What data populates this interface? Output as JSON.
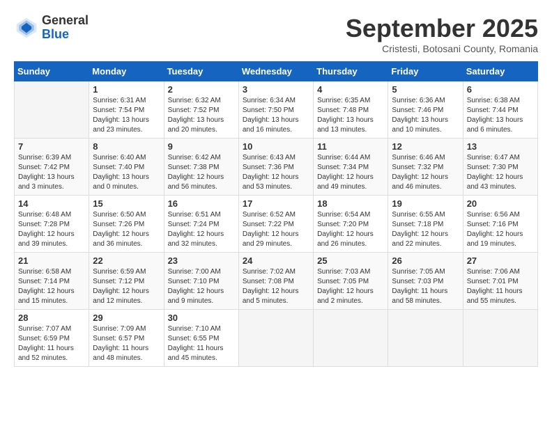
{
  "logo": {
    "general": "General",
    "blue": "Blue"
  },
  "header": {
    "month": "September 2025",
    "location": "Cristesti, Botosani County, Romania"
  },
  "weekdays": [
    "Sunday",
    "Monday",
    "Tuesday",
    "Wednesday",
    "Thursday",
    "Friday",
    "Saturday"
  ],
  "weeks": [
    [
      {
        "day": "",
        "sunrise": "",
        "sunset": "",
        "daylight": ""
      },
      {
        "day": "1",
        "sunrise": "Sunrise: 6:31 AM",
        "sunset": "Sunset: 7:54 PM",
        "daylight": "Daylight: 13 hours and 23 minutes."
      },
      {
        "day": "2",
        "sunrise": "Sunrise: 6:32 AM",
        "sunset": "Sunset: 7:52 PM",
        "daylight": "Daylight: 13 hours and 20 minutes."
      },
      {
        "day": "3",
        "sunrise": "Sunrise: 6:34 AM",
        "sunset": "Sunset: 7:50 PM",
        "daylight": "Daylight: 13 hours and 16 minutes."
      },
      {
        "day": "4",
        "sunrise": "Sunrise: 6:35 AM",
        "sunset": "Sunset: 7:48 PM",
        "daylight": "Daylight: 13 hours and 13 minutes."
      },
      {
        "day": "5",
        "sunrise": "Sunrise: 6:36 AM",
        "sunset": "Sunset: 7:46 PM",
        "daylight": "Daylight: 13 hours and 10 minutes."
      },
      {
        "day": "6",
        "sunrise": "Sunrise: 6:38 AM",
        "sunset": "Sunset: 7:44 PM",
        "daylight": "Daylight: 13 hours and 6 minutes."
      }
    ],
    [
      {
        "day": "7",
        "sunrise": "Sunrise: 6:39 AM",
        "sunset": "Sunset: 7:42 PM",
        "daylight": "Daylight: 13 hours and 3 minutes."
      },
      {
        "day": "8",
        "sunrise": "Sunrise: 6:40 AM",
        "sunset": "Sunset: 7:40 PM",
        "daylight": "Daylight: 13 hours and 0 minutes."
      },
      {
        "day": "9",
        "sunrise": "Sunrise: 6:42 AM",
        "sunset": "Sunset: 7:38 PM",
        "daylight": "Daylight: 12 hours and 56 minutes."
      },
      {
        "day": "10",
        "sunrise": "Sunrise: 6:43 AM",
        "sunset": "Sunset: 7:36 PM",
        "daylight": "Daylight: 12 hours and 53 minutes."
      },
      {
        "day": "11",
        "sunrise": "Sunrise: 6:44 AM",
        "sunset": "Sunset: 7:34 PM",
        "daylight": "Daylight: 12 hours and 49 minutes."
      },
      {
        "day": "12",
        "sunrise": "Sunrise: 6:46 AM",
        "sunset": "Sunset: 7:32 PM",
        "daylight": "Daylight: 12 hours and 46 minutes."
      },
      {
        "day": "13",
        "sunrise": "Sunrise: 6:47 AM",
        "sunset": "Sunset: 7:30 PM",
        "daylight": "Daylight: 12 hours and 43 minutes."
      }
    ],
    [
      {
        "day": "14",
        "sunrise": "Sunrise: 6:48 AM",
        "sunset": "Sunset: 7:28 PM",
        "daylight": "Daylight: 12 hours and 39 minutes."
      },
      {
        "day": "15",
        "sunrise": "Sunrise: 6:50 AM",
        "sunset": "Sunset: 7:26 PM",
        "daylight": "Daylight: 12 hours and 36 minutes."
      },
      {
        "day": "16",
        "sunrise": "Sunrise: 6:51 AM",
        "sunset": "Sunset: 7:24 PM",
        "daylight": "Daylight: 12 hours and 32 minutes."
      },
      {
        "day": "17",
        "sunrise": "Sunrise: 6:52 AM",
        "sunset": "Sunset: 7:22 PM",
        "daylight": "Daylight: 12 hours and 29 minutes."
      },
      {
        "day": "18",
        "sunrise": "Sunrise: 6:54 AM",
        "sunset": "Sunset: 7:20 PM",
        "daylight": "Daylight: 12 hours and 26 minutes."
      },
      {
        "day": "19",
        "sunrise": "Sunrise: 6:55 AM",
        "sunset": "Sunset: 7:18 PM",
        "daylight": "Daylight: 12 hours and 22 minutes."
      },
      {
        "day": "20",
        "sunrise": "Sunrise: 6:56 AM",
        "sunset": "Sunset: 7:16 PM",
        "daylight": "Daylight: 12 hours and 19 minutes."
      }
    ],
    [
      {
        "day": "21",
        "sunrise": "Sunrise: 6:58 AM",
        "sunset": "Sunset: 7:14 PM",
        "daylight": "Daylight: 12 hours and 15 minutes."
      },
      {
        "day": "22",
        "sunrise": "Sunrise: 6:59 AM",
        "sunset": "Sunset: 7:12 PM",
        "daylight": "Daylight: 12 hours and 12 minutes."
      },
      {
        "day": "23",
        "sunrise": "Sunrise: 7:00 AM",
        "sunset": "Sunset: 7:10 PM",
        "daylight": "Daylight: 12 hours and 9 minutes."
      },
      {
        "day": "24",
        "sunrise": "Sunrise: 7:02 AM",
        "sunset": "Sunset: 7:08 PM",
        "daylight": "Daylight: 12 hours and 5 minutes."
      },
      {
        "day": "25",
        "sunrise": "Sunrise: 7:03 AM",
        "sunset": "Sunset: 7:05 PM",
        "daylight": "Daylight: 12 hours and 2 minutes."
      },
      {
        "day": "26",
        "sunrise": "Sunrise: 7:05 AM",
        "sunset": "Sunset: 7:03 PM",
        "daylight": "Daylight: 11 hours and 58 minutes."
      },
      {
        "day": "27",
        "sunrise": "Sunrise: 7:06 AM",
        "sunset": "Sunset: 7:01 PM",
        "daylight": "Daylight: 11 hours and 55 minutes."
      }
    ],
    [
      {
        "day": "28",
        "sunrise": "Sunrise: 7:07 AM",
        "sunset": "Sunset: 6:59 PM",
        "daylight": "Daylight: 11 hours and 52 minutes."
      },
      {
        "day": "29",
        "sunrise": "Sunrise: 7:09 AM",
        "sunset": "Sunset: 6:57 PM",
        "daylight": "Daylight: 11 hours and 48 minutes."
      },
      {
        "day": "30",
        "sunrise": "Sunrise: 7:10 AM",
        "sunset": "Sunset: 6:55 PM",
        "daylight": "Daylight: 11 hours and 45 minutes."
      },
      {
        "day": "",
        "sunrise": "",
        "sunset": "",
        "daylight": ""
      },
      {
        "day": "",
        "sunrise": "",
        "sunset": "",
        "daylight": ""
      },
      {
        "day": "",
        "sunrise": "",
        "sunset": "",
        "daylight": ""
      },
      {
        "day": "",
        "sunrise": "",
        "sunset": "",
        "daylight": ""
      }
    ]
  ]
}
